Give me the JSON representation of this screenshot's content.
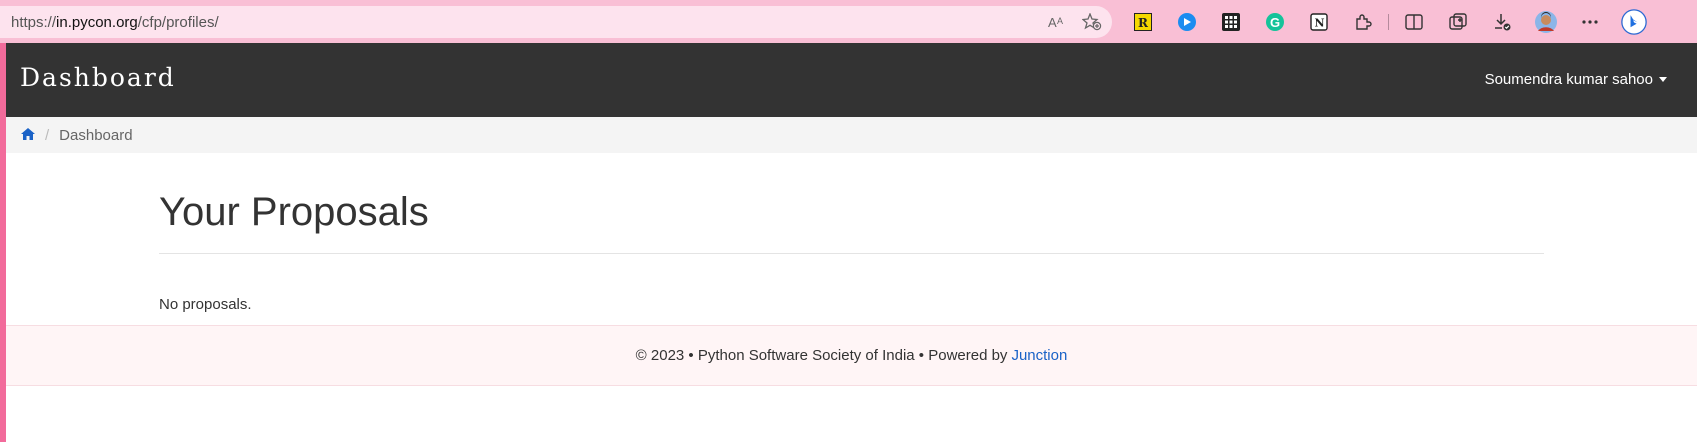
{
  "browser": {
    "url_prefix": "https://",
    "url_host": "in.pycon.org",
    "url_path": "/cfp/profiles/",
    "icons": [
      "read-aloud-icon",
      "add-favorite-icon"
    ],
    "extensions": [
      "reader-extension-icon",
      "media-extension-icon",
      "grid-extension-icon",
      "grammarly-extension-icon",
      "notion-extension-icon",
      "extensions-icon",
      "split-screen-icon",
      "collections-icon",
      "downloads-icon",
      "profile-avatar",
      "more-menu-icon",
      "bing-icon"
    ]
  },
  "navbar": {
    "brand": "Dashboard",
    "user_name": "Soumendra kumar sahoo"
  },
  "breadcrumb": {
    "home_icon": "home-icon",
    "separator": "/",
    "current": "Dashboard"
  },
  "main": {
    "title": "Your Proposals",
    "empty_message": "No proposals."
  },
  "footer": {
    "text": "© 2023 • Python Software Society of India • Powered by",
    "link_text": "Junction"
  },
  "colors": {
    "navbar_bg": "#333333",
    "link": "#1a62c7",
    "browser_accent": "#f26b9b"
  }
}
